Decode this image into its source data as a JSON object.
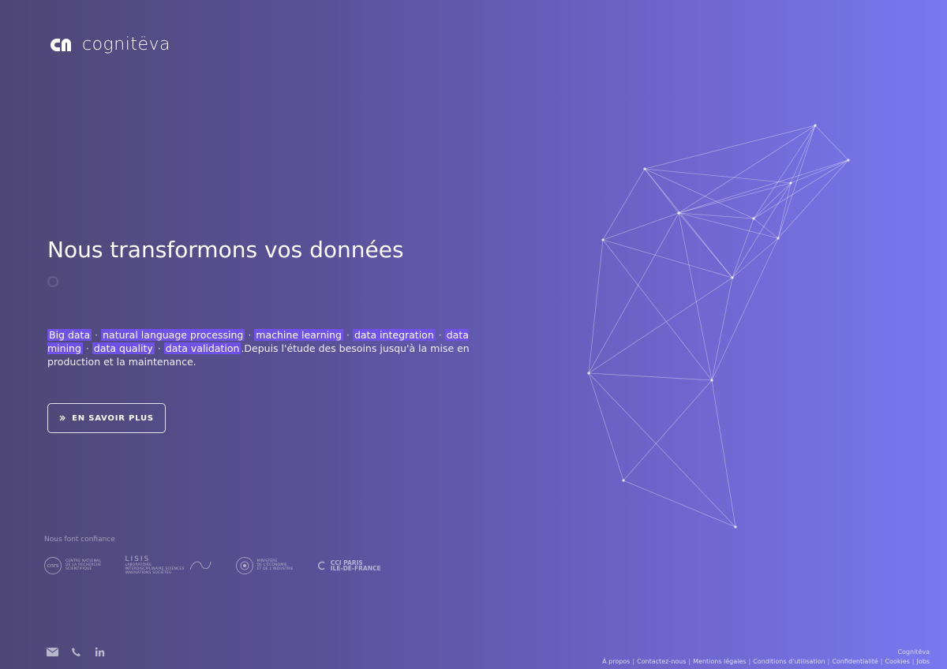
{
  "brand": {
    "name": "cognitëva"
  },
  "hero": {
    "headline": "Nous transformons vos données",
    "tags": [
      "Big data",
      "natural language processing",
      "machine learning",
      "data integration",
      "data mining",
      "data quality",
      "data validation"
    ],
    "tag_separator": "·",
    "description": ".Depuis l'étude des besoins jusqu'à la mise en production et la maintenance.",
    "cta": {
      "icon": "double-chevron-right-icon",
      "label": "EN SAVOIR PLUS"
    }
  },
  "trust": {
    "label": "Nous font confiance",
    "partners": [
      {
        "logo": "cnrs",
        "mark": "cnrs",
        "caption_lines": [
          "Centre national",
          "de la recherche",
          "scientifique"
        ]
      },
      {
        "logo": "lisis",
        "name": "LISIS",
        "caption_lines": [
          "Laboratoire",
          "interdisciplinaire sciences",
          "innovations sociétés"
        ]
      },
      {
        "logo": "ministere",
        "caption_lines": [
          "Ministère",
          "de l'économie",
          "et de l'industrie"
        ]
      },
      {
        "logo": "cci",
        "name_lines": [
          "CCI PARIS",
          "ILE-DE-FRANCE"
        ]
      }
    ]
  },
  "social": [
    {
      "icon": "envelope-icon"
    },
    {
      "icon": "phone-icon"
    },
    {
      "icon": "linkedin-icon"
    }
  ],
  "footer": {
    "company": "Cognitëva",
    "links": [
      "À propos",
      "Contactez-nous",
      "Mentions légales",
      "Conditions d'utilisation",
      "Confidentialité",
      "Cookies",
      "Jobs"
    ],
    "link_separator": "|"
  },
  "colors": {
    "tag_highlight": "#6f52e8",
    "gradient_start": "#4e4774",
    "gradient_end": "#7978ef"
  }
}
